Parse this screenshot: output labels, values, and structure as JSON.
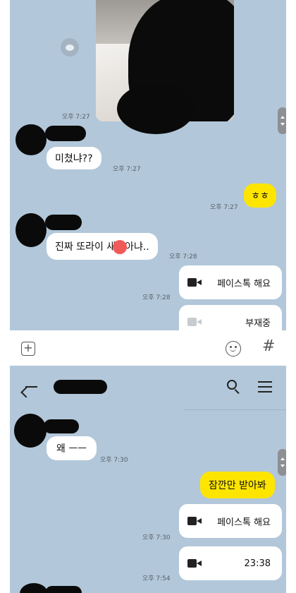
{
  "chat1": {
    "messages": [
      {
        "text": "미쳤냐??",
        "time": "오후 7:27"
      },
      {
        "text": "ㅎㅎ",
        "time": "오후 7:27"
      },
      {
        "text": "진짜 또라이 새끼아냐..",
        "time": "오후 7:28"
      }
    ],
    "photo_time": "오후 7:27",
    "calls": [
      {
        "label": "페이스톡 해요",
        "time": "오후 7:28",
        "icon": "video-camera-icon"
      },
      {
        "label": "부재중",
        "icon": "missed-video-call-icon"
      }
    ]
  },
  "input_bar": {
    "plus": "+",
    "hash": "#"
  },
  "chat2": {
    "messages": [
      {
        "text": "왜 ㅡㅡ",
        "time": "오후 7:30"
      },
      {
        "text": "잠깐만 받아봐"
      }
    ],
    "calls": [
      {
        "label": "페이스톡 해요",
        "time": "오후 7:30",
        "icon": "video-camera-icon"
      },
      {
        "label": "23:38",
        "time": "오후 7:54",
        "icon": "video-camera-icon"
      }
    ]
  },
  "colors": {
    "chat_background": "#b2c7d9",
    "my_bubble": "#fee500",
    "their_bubble": "#ffffff",
    "redaction": "#0a0a0a"
  }
}
